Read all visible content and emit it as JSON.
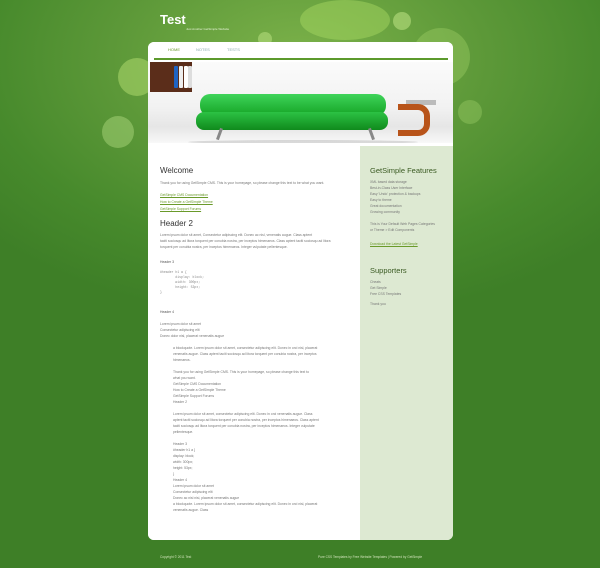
{
  "site": {
    "title": "Test",
    "tagline": "Just Another GetSimple Website"
  },
  "nav": {
    "items": [
      "HOME",
      "NOTES",
      "TESTS"
    ]
  },
  "main": {
    "welcome_title": "Welcome",
    "welcome_text": "Thank you for using GetSimple CMS. This is your homepage, so please change this text to be what you want.",
    "links": [
      "GetSimple CMS Documentation",
      "How to Create a GetSimple Theme",
      "GetSimple Support Forums"
    ],
    "header2": "Header 2",
    "para1": [
      "Lorem ipsum dolor sit amet, Consectetur adipiscing elit. Donec ac nisl, venenatis augue. Class aptent",
      "taciti sociosqu ad litora torquent per conubia nostra, per inceptos himenaeos. Class aptent taciti sociosqu ad litora",
      "torquent per conubia nostra, per inceptos himenaeos. Integer vulputate pellentesque."
    ],
    "header3": "Header 3",
    "code": "#header h1 a {\n        display: block;\n        width: 300px;\n        height: 53px;\n}",
    "header4": "Header 4",
    "para2": [
      "Lorem ipsum dolor sit amet",
      "Consectetur adipiscing elit",
      "Donec dolor nisl, placerat venenatis augue"
    ],
    "quote": [
      "a blockquote. Lorem ipsum dolor sit amet, consectetur adipiscing elit. Donec in orci nisl, placerat",
      "venenatis augue. Class aptent taciti sociosqu ad litora torquent per conubia nostra, per inceptos",
      "himenaeos."
    ],
    "list2": [
      "Thank you for using GetSimple CMS. This is your homepage, so please change this text to",
      "what you want.",
      "GetSimple CMS Documentation",
      "How to Create a GetSimple Theme",
      "GetSimple Support Forums",
      "Header 2"
    ],
    "para3": [
      "Lorem ipsum dolor sit amet, consectetur adipiscing elit. Donec in orci venenatis augue. Class",
      "aptent taciti sociosqu ad litora torquent per conubia nostra, per inceptos himenaeos. Class aptent",
      "taciti sociosqu ad litora torquent per conubia nostra, per inceptos himenaeos. Integer vulputate",
      "pellentesque."
    ],
    "list3": [
      "Header 3",
      "#header h1 a {",
      "display: block;",
      "width: 300px;",
      "height: 53px;",
      "}",
      "Header 4",
      "Lorem ipsum dolor sit amet",
      "Consectetur adipiscing elit",
      "Donec ac nisl nisi, placerat venenatis augue",
      "a blockquote. Lorem ipsum dolor sit amet, consectetur adipiscing elit. Donec in orci nisl, placerat",
      "venenatis augue. Class"
    ]
  },
  "sidebar": {
    "features_title": "GetSimple Features",
    "features": [
      "XML based data storage",
      "Best-in-Class User Interface",
      "Easy 'Undo' protection & backups",
      "Easy to theme",
      "Great documentation",
      "Growing community"
    ],
    "features_note": [
      "This is Your Default Web Pages Categories",
      "or Theme > Edit Components"
    ],
    "features_link": "Download the Latest GetSimple",
    "supporters_title": "Supporters",
    "supporters": [
      "Cheats",
      "Get Simple",
      "Free CSS Templates"
    ],
    "thanks": "Thank you"
  },
  "footer": {
    "left": "Copyright © 2011 Test",
    "right": "Pure CSS Templates by Free Website Templates | Powered by GetSimple"
  }
}
